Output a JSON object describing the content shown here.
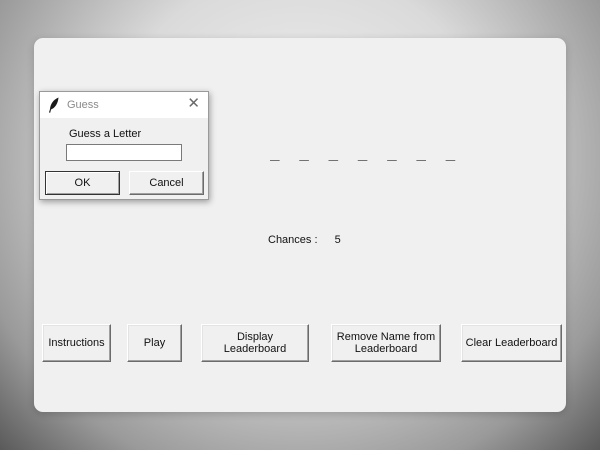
{
  "main_window": {
    "word_display": "_ _ _ _ _ _ _",
    "chances_label": "Chances :",
    "chances_value": "5",
    "buttons": {
      "instructions": "Instructions",
      "play": "Play",
      "display_leaderboard": "Display Leaderboard",
      "remove_name": "Remove Name from Leaderboard",
      "clear_leaderboard": "Clear Leaderboard"
    }
  },
  "dialog": {
    "title": "Guess",
    "prompt": "Guess a Letter",
    "input_value": "",
    "ok_label": "OK",
    "cancel_label": "Cancel",
    "icon": "feather-icon",
    "close_icon": "close-icon"
  }
}
